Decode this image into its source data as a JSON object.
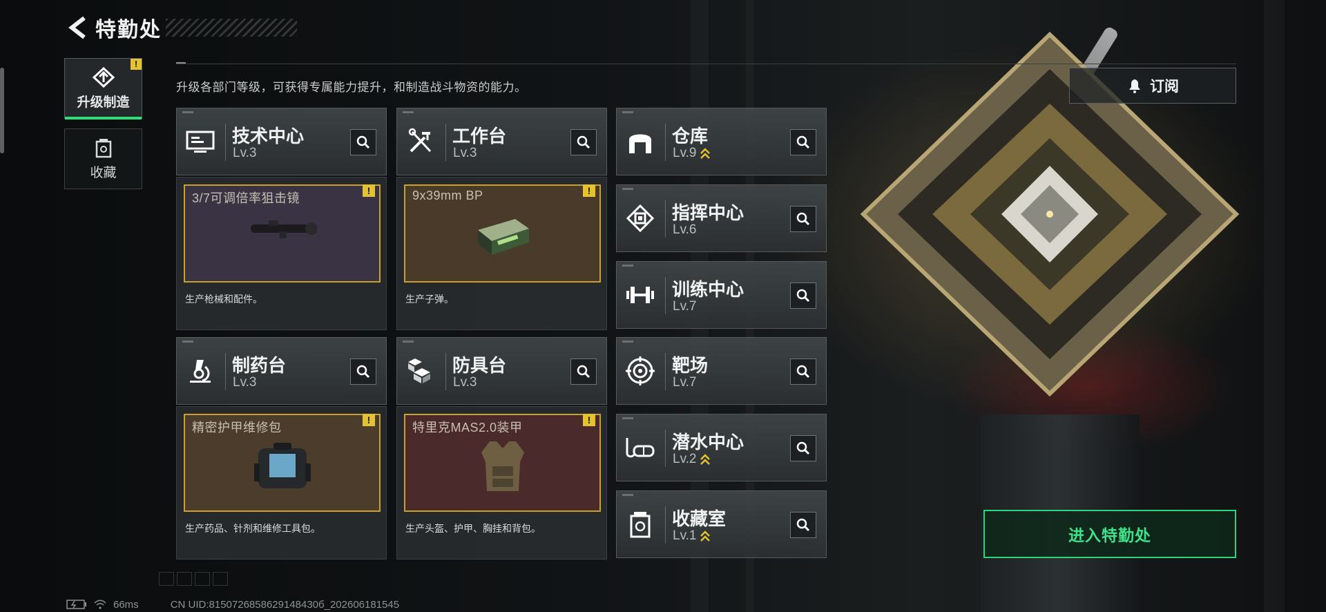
{
  "header": {
    "title": "特勤处"
  },
  "sidebar": {
    "tabs": [
      {
        "label": "升级制造",
        "badge": "!",
        "icon": "upgrade-craft-icon"
      },
      {
        "label": "收藏",
        "icon": "collection-icon"
      }
    ]
  },
  "subtitle": "升级各部门等级，可获得专属能力提升，和制造战斗物资的能力。",
  "departments": [
    {
      "name": "技术中心",
      "level": "Lv.3",
      "icon": "monitor-icon"
    },
    {
      "name": "工作台",
      "level": "Lv.3",
      "icon": "tools-icon"
    },
    {
      "name": "仓库",
      "level": "Lv.9",
      "icon": "warehouse-icon",
      "upgradable": true
    },
    {
      "name": "指挥中心",
      "level": "Lv.6",
      "icon": "command-chip-icon"
    },
    {
      "name": "训练中心",
      "level": "Lv.7",
      "icon": "dumbbell-icon"
    },
    {
      "name": "制药台",
      "level": "Lv.3",
      "icon": "microscope-icon"
    },
    {
      "name": "防具台",
      "level": "Lv.3",
      "icon": "armor-cubes-icon"
    },
    {
      "name": "靶场",
      "level": "Lv.7",
      "icon": "target-icon"
    },
    {
      "name": "潜水中心",
      "level": "Lv.2",
      "icon": "dive-mask-icon",
      "upgradable": true
    },
    {
      "name": "收藏室",
      "level": "Lv.1",
      "icon": "collection-room-icon",
      "upgradable": true
    }
  ],
  "production": [
    {
      "item": "3/7可调倍率狙击镜",
      "desc": "生产枪械和配件。",
      "badge": "!",
      "bg": "#3a3343"
    },
    {
      "item": "9x39mm BP",
      "desc": "生产子弹。",
      "badge": "!",
      "bg": "#4a3a2a"
    },
    {
      "item": "精密护甲维修包",
      "desc": "生产药品、针剂和维修工具包。",
      "badge": "!",
      "bg": "#4b3c2c"
    },
    {
      "item": "特里克MAS2.0装甲",
      "desc": "生产头盔、护甲、胸挂和背包。",
      "badge": "!",
      "bg": "#4a2a2b"
    }
  ],
  "right": {
    "subscribe_label": "订阅",
    "enter_label": "进入特勤处"
  },
  "status": {
    "ping": "66ms",
    "uid": "CN UID:8150726858629148430б_202606181545"
  },
  "colors": {
    "accent_green": "#2fd57a",
    "warning_yellow": "#e5c330",
    "item_border": "#c9a12f"
  }
}
